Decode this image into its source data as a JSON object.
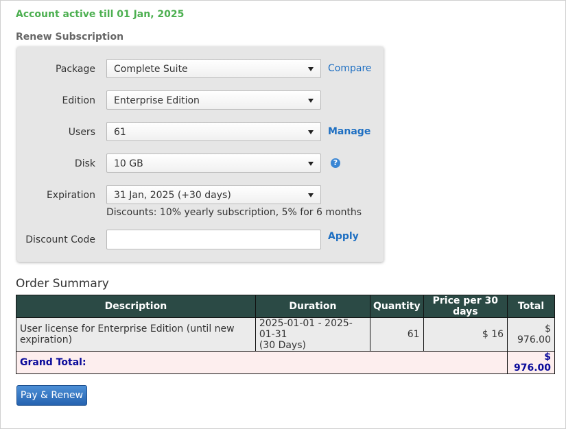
{
  "account_status": "Account active till 01 Jan, 2025",
  "renew_title": "Renew Subscription",
  "form": {
    "package": {
      "label": "Package",
      "value": "Complete Suite",
      "link": "Compare"
    },
    "edition": {
      "label": "Edition",
      "value": "Enterprise Edition"
    },
    "users": {
      "label": "Users",
      "value": "61",
      "link": "Manage"
    },
    "disk": {
      "label": "Disk",
      "value": "10 GB",
      "help_icon": "?"
    },
    "expiration": {
      "label": "Expiration",
      "value": "31 Jan, 2025 (+30 days)",
      "discount_note": "Discounts: 10% yearly subscription, 5% for 6 months"
    },
    "discount_code": {
      "label": "Discount Code",
      "value": "",
      "link": "Apply"
    }
  },
  "order_summary": {
    "title": "Order Summary",
    "headers": [
      "Description",
      "Duration",
      "Quantity",
      "Price per 30 days",
      "Total"
    ],
    "row": {
      "description": "User license for Enterprise Edition (until new expiration)",
      "duration_line1": "2025-01-01 - 2025-01-31",
      "duration_line2": "(30 Days)",
      "quantity": "61",
      "price": "$ 16",
      "total": "$ 976.00"
    },
    "grand_total_label": "Grand Total:",
    "grand_total_value": "$ 976.00"
  },
  "pay_button": "Pay & Renew",
  "colors": {
    "accent": "#1e6fc2",
    "success": "#4caf50",
    "header_bg": "#2b4a45",
    "grand_total": "#0a0a9a"
  }
}
